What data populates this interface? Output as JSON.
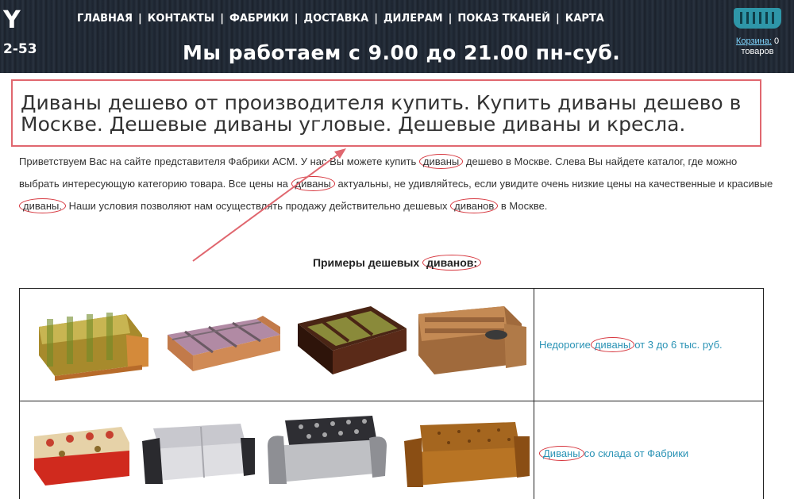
{
  "header": {
    "logo_letter": "Y",
    "phone_fragment": "2-53",
    "nav": [
      "ГЛАВНАЯ",
      "КОНТАКТЫ",
      "ФАБРИКИ",
      "ДОСТАВКА",
      "ДИЛЕРАМ",
      "ПОКАЗ ТКАНЕЙ",
      "КАРТА"
    ],
    "nav_separator": "|",
    "hours": "Мы работаем с 9.00 до 21.00 пн-суб.",
    "cart": {
      "link": "Корзина:",
      "count": "0",
      "unit": "товаров"
    }
  },
  "title": "Диваны дешево от производителя купить. Купить диваны дешево в Москве. Дешевые диваны угловые. Дешевые диваны и кресла.",
  "intro": {
    "p1": "Приветствуем Вас на сайте представителя Фабрики АСМ. У нас Вы можете купить",
    "w1": "диваны",
    "p2": "дешево в Москве. Слева Вы найдете каталог, где можно выбрать интересующую категорию товара. Все цены на",
    "w2": "диваны",
    "p3": "актуальны, не удивляйтесь, если увидите очень низкие цены на качественные и красивые",
    "w3": "диваны.",
    "p4": "Наши условия позволяют нам осуществлять продажу действительно дешевых",
    "w4": "диванов",
    "p5": "в Москве."
  },
  "examples": {
    "prefix": "Примеры дешевых",
    "word": "диванов:"
  },
  "rows": [
    {
      "pre": "Недорогие",
      "word": "диваны",
      "post": "от 3 до 6 тыс. руб."
    },
    {
      "pre": "",
      "word": "Диваны",
      "post": "со склада от Фабрики"
    }
  ],
  "colors": {
    "highlight": "#d6343c",
    "link": "#2a93b5",
    "header_bg": "#1d2530",
    "cart": "#2e96a8"
  }
}
